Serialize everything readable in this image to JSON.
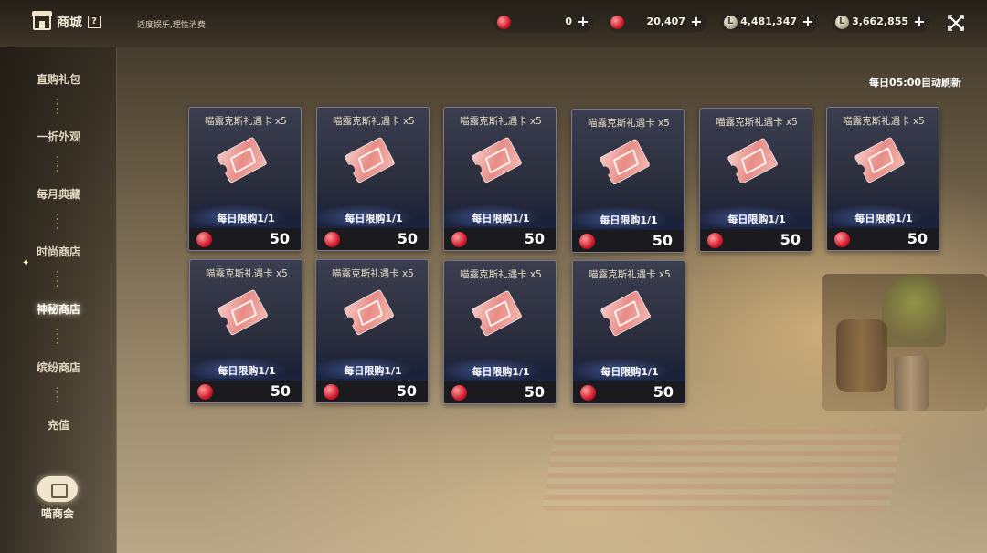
{
  "header": {
    "title": "商城",
    "help_icon": "?",
    "slogan": "适度娱乐,理性消费",
    "currencies": [
      {
        "icon": "red-gem",
        "value": "0"
      },
      {
        "icon": "red-gem",
        "value": "20,407"
      },
      {
        "icon": "silver-coin",
        "value": "4,481,347"
      },
      {
        "icon": "silver-coin",
        "value": "3,662,855"
      }
    ],
    "plus_label": "+"
  },
  "sidebar": {
    "items": [
      {
        "label": "直购礼包"
      },
      {
        "label": "一折外观"
      },
      {
        "label": "每月典藏"
      },
      {
        "label": "时尚商店"
      },
      {
        "label": "神秘商店"
      },
      {
        "label": "缤纷商店"
      },
      {
        "label": "充值"
      }
    ],
    "active_index": 4,
    "club_label": "喵商会"
  },
  "main": {
    "refresh_text": "每日05:00自动刷新",
    "items": [
      {
        "name": "喵露克斯礼遇卡 x5",
        "limit": "每日限购1/1",
        "price": "50"
      },
      {
        "name": "喵露克斯礼遇卡 x5",
        "limit": "每日限购1/1",
        "price": "50"
      },
      {
        "name": "喵露克斯礼遇卡 x5",
        "limit": "每日限购1/1",
        "price": "50"
      },
      {
        "name": "喵露克斯礼遇卡 x5",
        "limit": "每日限购1/1",
        "price": "50"
      },
      {
        "name": "喵露克斯礼遇卡 x5",
        "limit": "每日限购1/1",
        "price": "50"
      },
      {
        "name": "喵露克斯礼遇卡 x5",
        "limit": "每日限购1/1",
        "price": "50"
      },
      {
        "name": "喵露克斯礼遇卡 x5",
        "limit": "每日限购1/1",
        "price": "50"
      },
      {
        "name": "喵露克斯礼遇卡 x5",
        "limit": "每日限购1/1",
        "price": "50"
      },
      {
        "name": "喵露克斯礼遇卡 x5",
        "limit": "每日限购1/1",
        "price": "50"
      },
      {
        "name": "喵露克斯礼遇卡 x5",
        "limit": "每日限购1/1",
        "price": "50"
      }
    ]
  }
}
